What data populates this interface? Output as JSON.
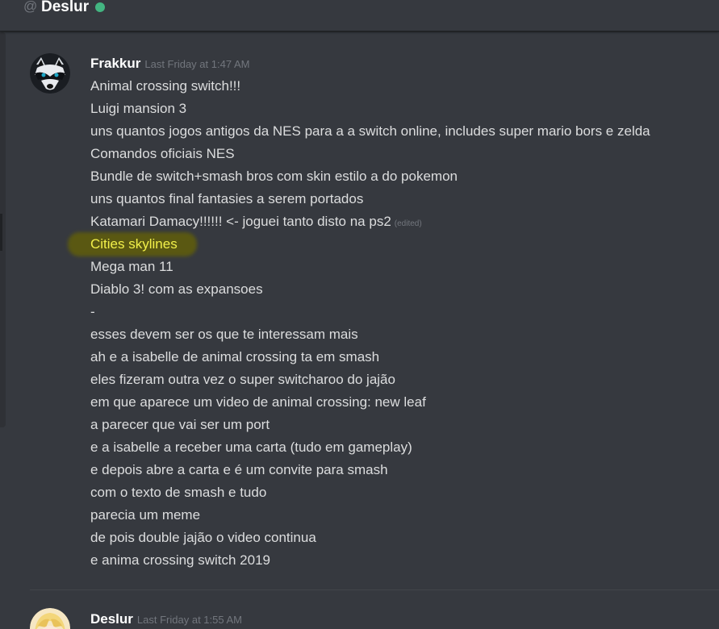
{
  "header": {
    "at_symbol": "@",
    "title": "Deslur",
    "status": "online",
    "status_color": "#43b581"
  },
  "messages": [
    {
      "author": "Frakkur",
      "timestamp": "Last Friday at 1:47 AM",
      "avatar": "raccoon-avatar",
      "lines": [
        "Animal crossing switch!!!",
        "Luigi mansion 3",
        "uns quantos jogos antigos da NES para a a switch online, includes super mario bors e zelda",
        "Comandos oficiais NES",
        "Bundle de switch+smash bros com skin estilo a do pokemon",
        "uns quantos final fantasies a serem portados",
        "Katamari Damacy!!!!!! <- joguei tanto disto na ps2",
        "Cities skylines",
        "Mega man 11",
        "Diablo 3! com as expansoes",
        "-",
        "esses devem ser os que te interessam mais",
        "ah e a isabelle de animal crossing ta em smash",
        "eles fizeram outra vez o super switcharoo do jajão",
        "em que aparece um video de animal crossing: new leaf",
        "a parecer que vai ser um port",
        "e a isabelle a receber uma carta (tudo em gameplay)",
        "e depois abre a carta e é um convite para smash",
        "com o texto de smash e tudo",
        "parecia um meme",
        "de pois double jajão o video continua",
        "e anima crossing switch 2019"
      ],
      "edited_label": "(edited)",
      "highlight_color": "#f2f04a"
    },
    {
      "author": "Deslur",
      "timestamp": "Last Friday at 1:55 AM",
      "avatar": "anime-girl-avatar"
    }
  ]
}
